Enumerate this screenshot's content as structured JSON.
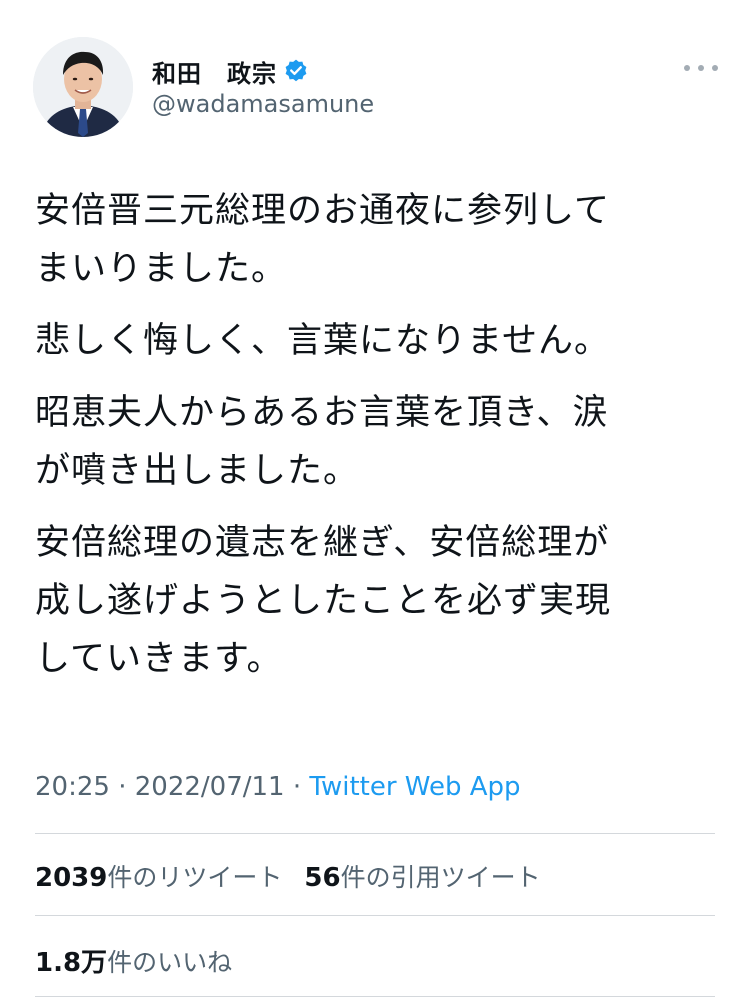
{
  "user": {
    "display_name": "和田　政宗",
    "handle": "@wadamasamune",
    "verified_color": "#1d9bf0"
  },
  "tweet": {
    "paragraphs": [
      "安倍晋三元総理のお通夜に参列して\nまいりました。",
      "悲しく悔しく、言葉になりません。",
      "昭恵夫人からあるお言葉を頂き、涙\nが噴き出しました。",
      "安倍総理の遺志を継ぎ、安倍総理が\n成し遂げようとしたことを必ず実現\nしていきます。"
    ],
    "time": "20:25",
    "separator": " · ",
    "date": "2022/07/11",
    "source": "Twitter Web App"
  },
  "stats": {
    "retweets_count": "2039",
    "retweets_label": "件のリツイート",
    "quotes_count": "56",
    "quotes_label": "件の引用ツイート",
    "likes_count": "1.8万",
    "likes_label": "件のいいね"
  },
  "colors": {
    "text": "#0f1419",
    "secondary": "#536471",
    "link": "#1d9bf0"
  }
}
